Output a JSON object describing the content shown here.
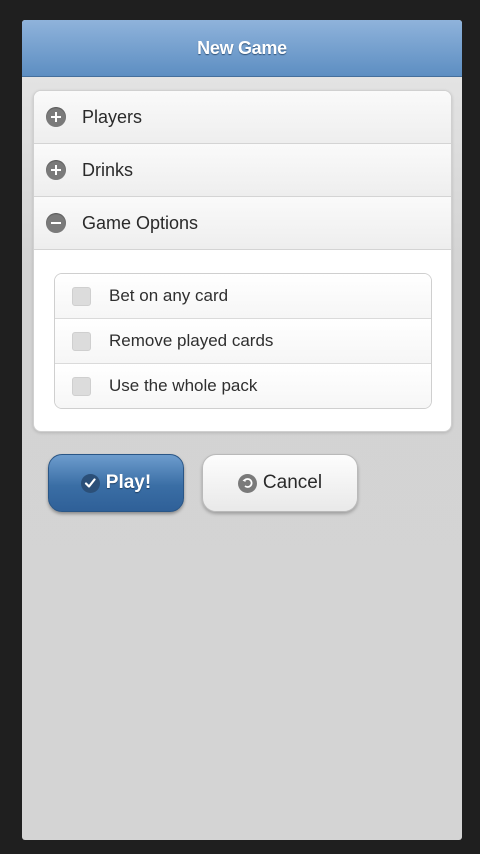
{
  "header": {
    "title": "New Game"
  },
  "accordion": {
    "sections": [
      {
        "label": "Players",
        "icon": "plus-circle-icon",
        "expanded": false
      },
      {
        "label": "Drinks",
        "icon": "plus-circle-icon",
        "expanded": false
      },
      {
        "label": "Game Options",
        "icon": "minus-circle-icon",
        "expanded": true
      }
    ],
    "options": [
      {
        "label": "Bet on any card",
        "checked": false
      },
      {
        "label": "Remove played cards",
        "checked": false
      },
      {
        "label": "Use the whole pack",
        "checked": false
      }
    ]
  },
  "buttons": {
    "play": {
      "label": "Play!",
      "icon": "check-circle-icon"
    },
    "cancel": {
      "label": "Cancel",
      "icon": "back-arrow-circle-icon"
    }
  },
  "colors": {
    "header_bg": "#6f9ccd",
    "play_button_bg": "#3a6ea5",
    "screen_bg": "#d4d4d4",
    "frame": "#1f1f1f"
  }
}
